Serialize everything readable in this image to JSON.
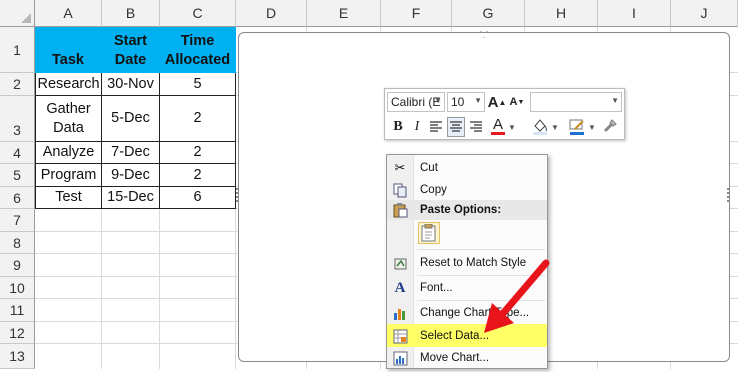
{
  "columns": [
    "A",
    "B",
    "C",
    "D",
    "E",
    "F",
    "G",
    "H",
    "I",
    "J"
  ],
  "rows": [
    "1",
    "2",
    "3",
    "4",
    "5",
    "6",
    "7",
    "8",
    "9",
    "10",
    "11",
    "12",
    "13"
  ],
  "table": {
    "headers": [
      "Task",
      "Start Date",
      "Time Allocated"
    ],
    "rows": [
      [
        "Research",
        "30-Nov",
        "5"
      ],
      [
        "Gather Data",
        "5-Dec",
        "2"
      ],
      [
        "Analyze",
        "7-Dec",
        "2"
      ],
      [
        "Program",
        "9-Dec",
        "2"
      ],
      [
        "Test",
        "15-Dec",
        "6"
      ]
    ]
  },
  "format_bar": {
    "font": "Calibri (E",
    "size": "10",
    "bold": "B",
    "italic": "I",
    "grow_font": "A",
    "shrink_font": "A",
    "font_color_letter": "A"
  },
  "context_menu": {
    "items": [
      {
        "label": "Cut",
        "icon": "scissors-icon"
      },
      {
        "label": "Copy",
        "icon": "copy-icon"
      },
      {
        "label": "Paste Options:",
        "icon": "paste-icon"
      },
      {
        "label": "Reset to Match Style",
        "icon": "reset-style-icon"
      },
      {
        "label": "Font...",
        "icon": "font-icon"
      },
      {
        "label": "Change Chart Type...",
        "icon": "chart-type-icon"
      },
      {
        "label": "Select Data...",
        "icon": "select-data-icon"
      },
      {
        "label": "Move Chart...",
        "icon": "move-chart-icon"
      }
    ],
    "highlight_color": "#ffff66"
  },
  "colors": {
    "header_fill": "#00b0f0",
    "arrow": "#e8141b"
  }
}
